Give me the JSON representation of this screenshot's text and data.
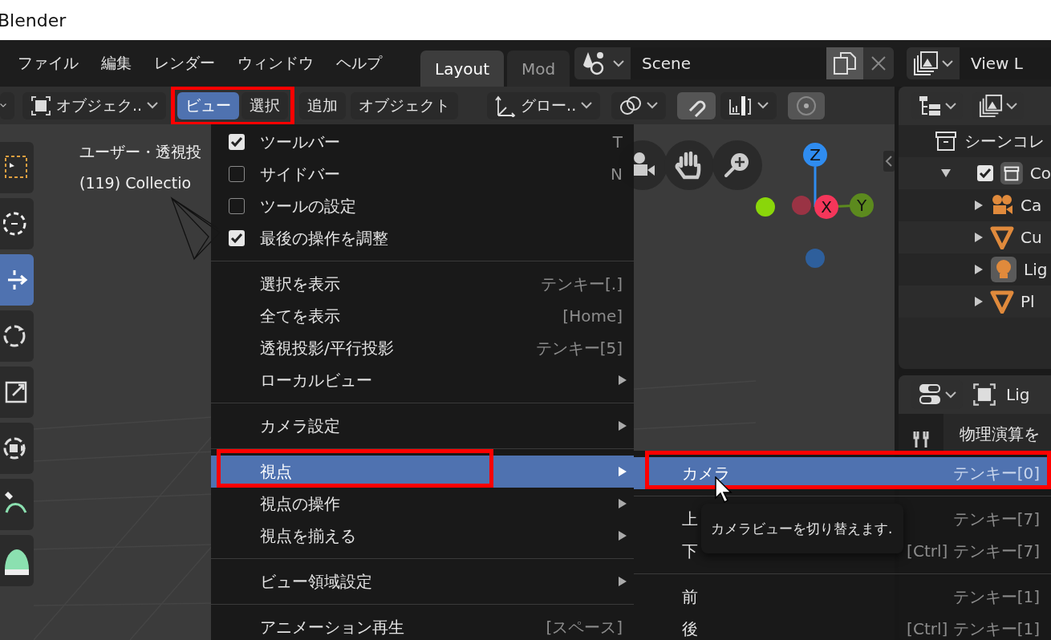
{
  "window": {
    "title": "Blender"
  },
  "menubar": {
    "menus": [
      "ファイル",
      "編集",
      "レンダー",
      "ウィンドウ",
      "ヘルプ"
    ],
    "workspaces": [
      {
        "label": "Layout",
        "selected": true
      },
      {
        "label": "Mod",
        "selected": false
      }
    ],
    "scene": {
      "value": "Scene"
    },
    "view_layer": {
      "value": "View L"
    }
  },
  "viewport_header": {
    "mode": "オブジェク..",
    "orientation": "グロー..",
    "snap": {
      "on": true
    },
    "proportional": {
      "on": true
    },
    "menus": [
      {
        "label": "ビュー",
        "selected": true,
        "in_red_frame": true
      },
      {
        "label": "選択",
        "selected": false,
        "in_red_frame": true
      },
      {
        "label": "追加",
        "selected": false,
        "in_red_frame": false
      },
      {
        "label": "オブジェクト",
        "selected": false,
        "in_red_frame": false
      }
    ]
  },
  "toolbar": {
    "tools": [
      {
        "kind": "select",
        "selected": false
      },
      {
        "kind": "cursor",
        "selected": false
      },
      {
        "kind": "move",
        "selected": true
      },
      {
        "kind": "rotate",
        "selected": false
      },
      {
        "kind": "scale",
        "selected": false
      },
      {
        "kind": "transform",
        "selected": false
      },
      {
        "kind": "annotate",
        "selected": false
      },
      {
        "kind": "measure",
        "selected": false
      }
    ]
  },
  "viewport": {
    "info": [
      "ユーザー・透視投",
      "(119) Collectio"
    ],
    "gizmo": [
      {
        "label": "Z",
        "color": "#2f8cf0"
      },
      {
        "label": "X",
        "color": "#f5365a"
      },
      {
        "label": "Y",
        "color": "#5c8a1e"
      },
      {
        "color": "#8ad60a"
      },
      {
        "color": "#9a3344"
      },
      {
        "color": "#2e5f9c"
      }
    ]
  },
  "view_menu": {
    "groups": [
      [
        {
          "kind": "check",
          "label": "ツールバー",
          "shortcut": "T",
          "checked": true,
          "selected": false,
          "in_red_frame": false
        },
        {
          "kind": "check",
          "label": "サイドバー",
          "shortcut": "N",
          "checked": false,
          "selected": false,
          "in_red_frame": false
        },
        {
          "kind": "check",
          "label": "ツールの設定",
          "checked": false,
          "selected": false,
          "in_red_frame": false
        },
        {
          "kind": "check",
          "label": "最後の操作を調整",
          "checked": true,
          "selected": false,
          "in_red_frame": false
        }
      ],
      [
        {
          "kind": "action",
          "label": "選択を表示",
          "shortcut": "テンキー[.]",
          "selected": false,
          "in_red_frame": false
        },
        {
          "kind": "action",
          "label": "全てを表示",
          "shortcut": "[Home]",
          "selected": false,
          "in_red_frame": false
        },
        {
          "kind": "action",
          "label": "透視投影/平行投影",
          "shortcut": "テンキー[5]",
          "selected": false,
          "in_red_frame": false
        },
        {
          "kind": "submenu",
          "label": "ローカルビュー",
          "selected": false,
          "in_red_frame": false
        }
      ],
      [
        {
          "kind": "submenu",
          "label": "カメラ設定",
          "selected": false,
          "in_red_frame": false
        }
      ],
      [
        {
          "kind": "submenu",
          "label": "視点",
          "selected": true,
          "in_red_frame": true
        },
        {
          "kind": "submenu",
          "label": "視点の操作",
          "selected": false,
          "in_red_frame": false
        },
        {
          "kind": "submenu",
          "label": "視点を揃える",
          "selected": false,
          "in_red_frame": false
        }
      ],
      [
        {
          "kind": "submenu",
          "label": "ビュー領域設定",
          "selected": false,
          "in_red_frame": false
        }
      ],
      [
        {
          "kind": "action",
          "label": "アニメーション再生",
          "shortcut": "[スペース]",
          "selected": false,
          "in_red_frame": false
        }
      ]
    ]
  },
  "viewpoint_menu": {
    "groups": [
      [
        {
          "label": "カメラ",
          "shortcut": "テンキー[0]",
          "selected": true,
          "in_red_frame": true
        }
      ],
      [
        {
          "label": "上",
          "shortcut": "テンキー[7]",
          "selected": false,
          "in_red_frame": false
        },
        {
          "label": "下",
          "shortcut": "[Ctrl] テンキー[7]",
          "selected": false,
          "in_red_frame": false
        }
      ],
      [
        {
          "label": "前",
          "shortcut": "テンキー[1]",
          "selected": false,
          "in_red_frame": false
        },
        {
          "label": "後",
          "shortcut": "[Ctrl] テンキー[1]",
          "selected": false,
          "in_red_frame": false
        }
      ]
    ]
  },
  "tooltip": "カメラビューを切り替えます.",
  "outliner": {
    "root": "シーンコレ",
    "items": [
      {
        "label": "Co",
        "kind": "collection",
        "checked": true,
        "expanded": true,
        "children": [
          {
            "label": "Ca",
            "kind": "camera",
            "expanded": false
          },
          {
            "label": "Cu",
            "kind": "mesh",
            "expanded": false
          },
          {
            "label": "Lig",
            "kind": "light",
            "expanded": false
          },
          {
            "label": "Pl",
            "kind": "mesh",
            "expanded": false
          }
        ]
      }
    ]
  },
  "properties": {
    "title": "Lig",
    "section": "物理演算を"
  }
}
